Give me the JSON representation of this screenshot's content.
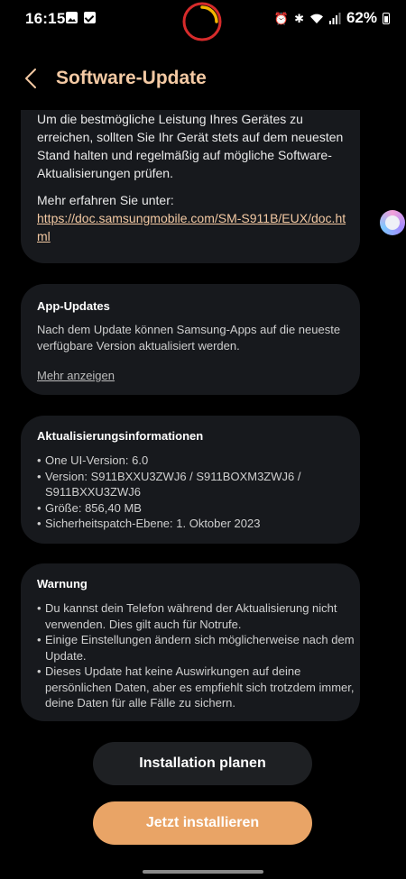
{
  "status_bar": {
    "time": "16:15",
    "battery": "62%",
    "left_icons": [
      "gallery-icon",
      "checkbox-icon"
    ],
    "right_icons": [
      "alarm-icon",
      "bluetooth-icon",
      "wifi-icon",
      "signal-icon",
      "battery-icon"
    ]
  },
  "header": {
    "title": "Software-Update"
  },
  "intro": {
    "text": "Um die bestmögliche Leistung Ihres Gerätes zu erreichen, sollten Sie Ihr Gerät stets auf dem neuesten Stand halten und regelmäßig auf mögliche Software-Aktualisierungen prüfen.",
    "more_label": "Mehr erfahren Sie unter:",
    "link": "https://doc.samsungmobile.com/SM-S911B/EUX/doc.html"
  },
  "app_updates": {
    "title": "App-Updates",
    "body": "Nach dem Update können Samsung-Apps auf die neueste verfügbare Version aktualisiert werden.",
    "show_more": "Mehr anzeigen"
  },
  "update_info": {
    "title": "Aktualisierungsinformationen",
    "items": [
      "One UI-Version: 6.0",
      "Version: S911BXXU3ZWJ6 / S911BOXM3ZWJ6 / S911BXXU3ZWJ6",
      "Größe: 856,40 MB",
      "Sicherheitspatch-Ebene: 1. Oktober 2023"
    ]
  },
  "warning": {
    "title": "Warnung",
    "items": [
      "Du kannst dein Telefon während der Aktualisierung nicht verwenden. Dies gilt auch für Notrufe.",
      "Einige Einstellungen ändern sich möglicherweise nach dem Update.",
      "Dieses Update hat keine Auswirkungen auf deine persönlichen Daten, aber es empfiehlt sich trotzdem immer, deine Daten für alle Fälle zu sichern."
    ]
  },
  "buttons": {
    "schedule": "Installation planen",
    "install": "Jetzt installieren"
  },
  "colors": {
    "accent": "#f3c9a3",
    "primary_button": "#e9a466",
    "card_background": "#17191d",
    "background": "#000000"
  }
}
